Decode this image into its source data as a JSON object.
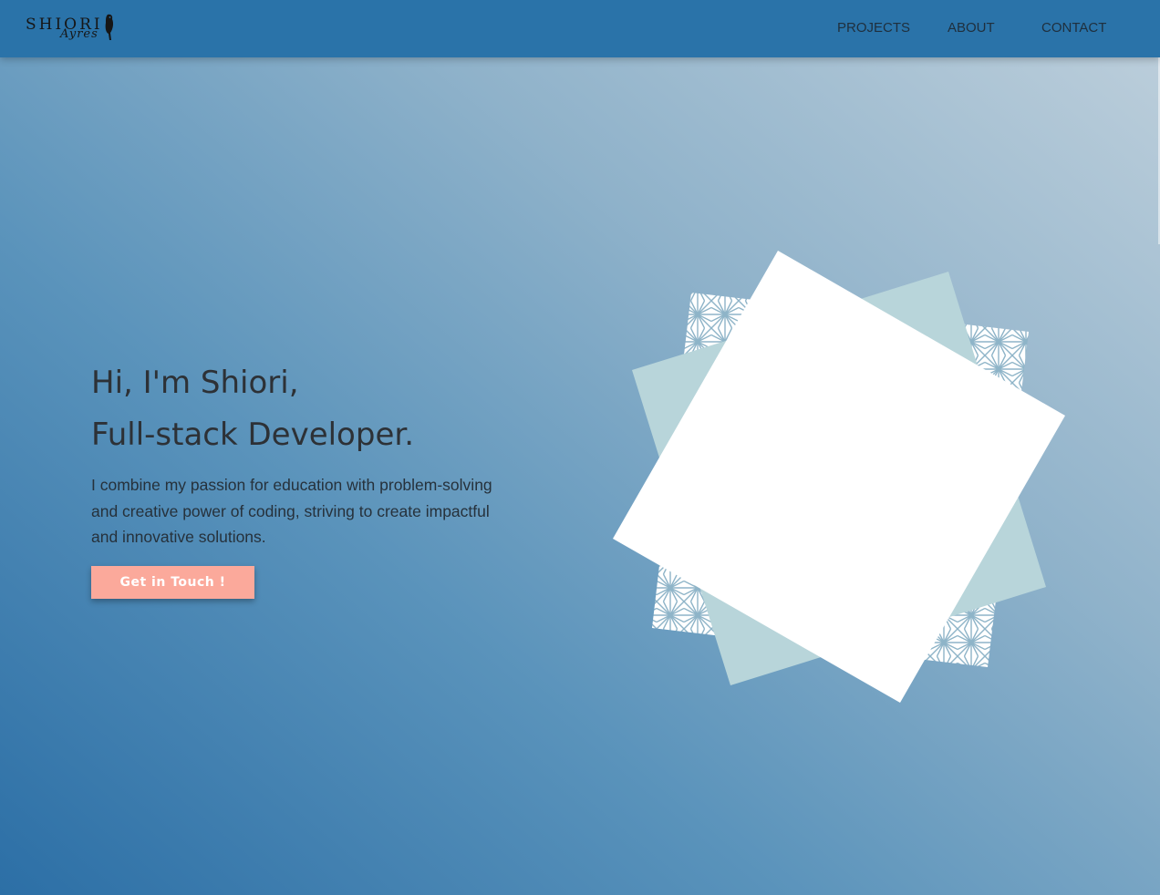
{
  "brand": {
    "logo_text": "SHIORI",
    "logo_script": "Ayres"
  },
  "nav": {
    "projects": "PROJECTS",
    "about": "ABOUT",
    "contact": "CONTACT"
  },
  "hero": {
    "heading_line1": "Hi, I'm Shiori,",
    "heading_line2": "Full-stack Developer.",
    "description": "I combine my passion for education with problem-solving and creative power of coding, striving to create impactful and innovative solutions.",
    "cta_label": "Get in Touch !"
  },
  "colors": {
    "header": "#2a73a9",
    "cta": "#fba99b",
    "paper_accent": "#b8d5da",
    "pattern": "#8eb4c8"
  }
}
